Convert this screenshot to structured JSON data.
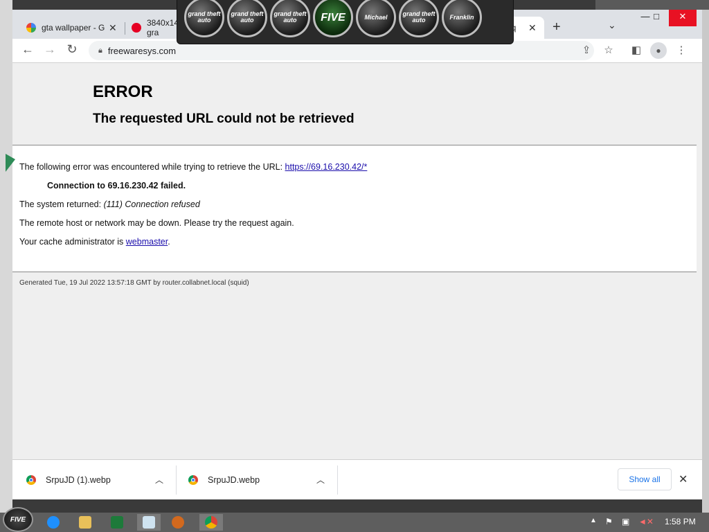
{
  "browser": {
    "tabs": [
      {
        "label": "gta wallpaper - G",
        "favicon": "google-icon"
      },
      {
        "label": "3840x1447 gra",
        "favicon": "pinterest-icon"
      },
      {
        "label": "req",
        "favicon": "page-icon"
      }
    ],
    "address": "freewaresys.com",
    "new_tab": "+",
    "tab_list": "⌄"
  },
  "gta_banner": {
    "badges": [
      "grand theft auto",
      "grand theft auto",
      "grand theft auto",
      "FIVE",
      "Michael",
      "grand theft auto",
      "Franklin"
    ]
  },
  "page": {
    "title": "ERROR",
    "subtitle": "The requested URL could not be retrieved",
    "line1_text": "The following error was encountered while trying to retrieve the URL: ",
    "line1_link": "https://69.16.230.42/*",
    "line2": "Connection to 69.16.230.42 failed.",
    "line3_text": "The system returned: ",
    "line3_em": "(111) Connection refused",
    "line4": "The remote host or network may be down. Please try the request again.",
    "line5_text": "Your cache administrator is ",
    "line5_link": "webmaster",
    "line5_end": ".",
    "generated": "Generated Tue, 19 Jul 2022 13:57:18 GMT by router.collabnet.local (squid)"
  },
  "downloads": {
    "items": [
      "SrpuJD (1).webp",
      "SrpuJD.webp"
    ],
    "show_all": "Show all"
  },
  "taskbar": {
    "start": "FIVE",
    "clock": "1:58 PM"
  }
}
